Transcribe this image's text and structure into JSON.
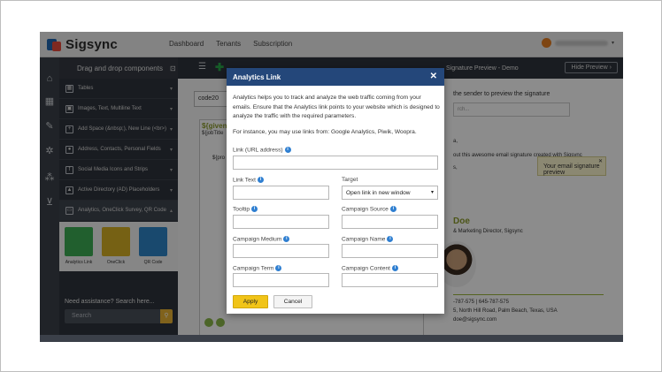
{
  "app": {
    "logo_text": "Sigsync",
    "nav": [
      "Dashboard",
      "Tenants",
      "Subscription"
    ]
  },
  "panel": {
    "title": "Drag and drop components",
    "items": [
      {
        "label": "Tables",
        "icon": "table-icon"
      },
      {
        "label": "Images, Text, Multiline Text",
        "icon": "image-icon"
      },
      {
        "label": "Add Space (&nbsp;), New Line (<br>)",
        "icon": "add-space-icon"
      },
      {
        "label": "Address, Contacts, Personal Fields",
        "icon": "person-icon"
      },
      {
        "label": "Social Media Icons and Strips",
        "icon": "facebook-icon"
      },
      {
        "label": "Active Directory (AD) Placeholders",
        "icon": "ad-icon"
      },
      {
        "label": "Analytics, OneClick Survey, QR Code",
        "icon": "analytics-icon"
      }
    ],
    "tiles": [
      {
        "label": "Analytics Link",
        "color": "#3cae54"
      },
      {
        "label": "OneClick",
        "color": "#d8b126"
      },
      {
        "label": "QR Code",
        "color": "#2f86c9"
      }
    ],
    "assist_text": "Need assistance? Search here...",
    "search_placeholder": "Search"
  },
  "editor": {
    "code_label": "code20",
    "given_text": "${given",
    "jobtitle_text": "${jobTitle",
    "pro_text": "${pro"
  },
  "preview": {
    "title": "Signature Preview - Demo",
    "hide_button": "Hide Preview",
    "sender_label": "the sender to preview the signature",
    "search_placeholder": "rch...",
    "line_a": "a,",
    "line_b": "out this awesome email signature created with Sigsync",
    "line_c": "s,",
    "tooltip": "Your email signature preview",
    "name": "Doe",
    "role": "& Marketing Director, Sigsync",
    "phone": "-787-575 | 645-787-575",
    "address": "5, North Hill Road, Palm Beach, Texas, USA",
    "email": "doe@sigsync.com"
  },
  "modal": {
    "title": "Analytics Link",
    "description": "Analytics helps you to track and analyze the web traffic coming from your emails. Ensure that the Analytics link points to your website which is designed to analyze the traffic with the required parameters.",
    "examples": "For instance, you may use links from: Google Analytics, Piwik, Woopra.",
    "fields": {
      "link_label": "Link (URL address)",
      "link_text_label": "Link Text",
      "target_label": "Target",
      "target_value": "Open link in new window",
      "tooltip_label": "Tooltip",
      "campaign_source_label": "Campaign Source",
      "campaign_medium_label": "Campaign Medium",
      "campaign_name_label": "Campaign Name",
      "campaign_term_label": "Campaign Term",
      "campaign_content_label": "Campaign Content"
    },
    "apply_label": "Apply",
    "cancel_label": "Cancel"
  }
}
